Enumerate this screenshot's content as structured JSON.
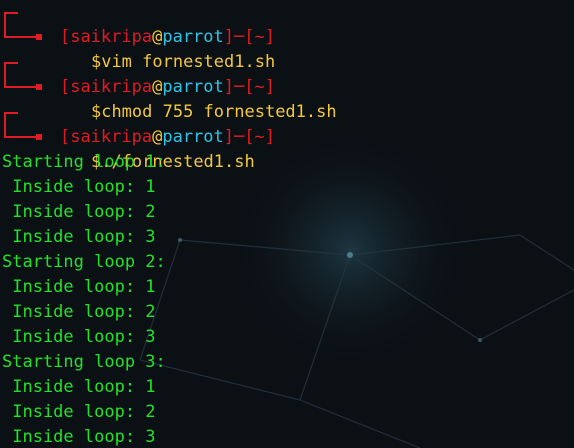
{
  "prompt": {
    "user": "saikripa",
    "at": "@",
    "host": "parrot",
    "dir": "~",
    "symbol": "$",
    "open_bracket": "[",
    "close_bracket": "]",
    "separator": "─"
  },
  "commands": [
    "vim fornested1.sh",
    "chmod 755 fornested1.sh",
    "./fornested1.sh"
  ],
  "output": [
    "Starting loop 1:",
    " Inside loop: 1",
    " Inside loop: 2",
    " Inside loop: 3",
    "Starting loop 2:",
    " Inside loop: 1",
    " Inside loop: 2",
    " Inside loop: 3",
    "Starting loop 3:",
    " Inside loop: 1",
    " Inside loop: 2",
    " Inside loop: 3"
  ],
  "colors": {
    "background": "#0b1015",
    "prompt_red": "#e01b24",
    "prompt_yellow": "#f3c93a",
    "host_cyan": "#2ec4e8",
    "output_green": "#22e22a"
  }
}
